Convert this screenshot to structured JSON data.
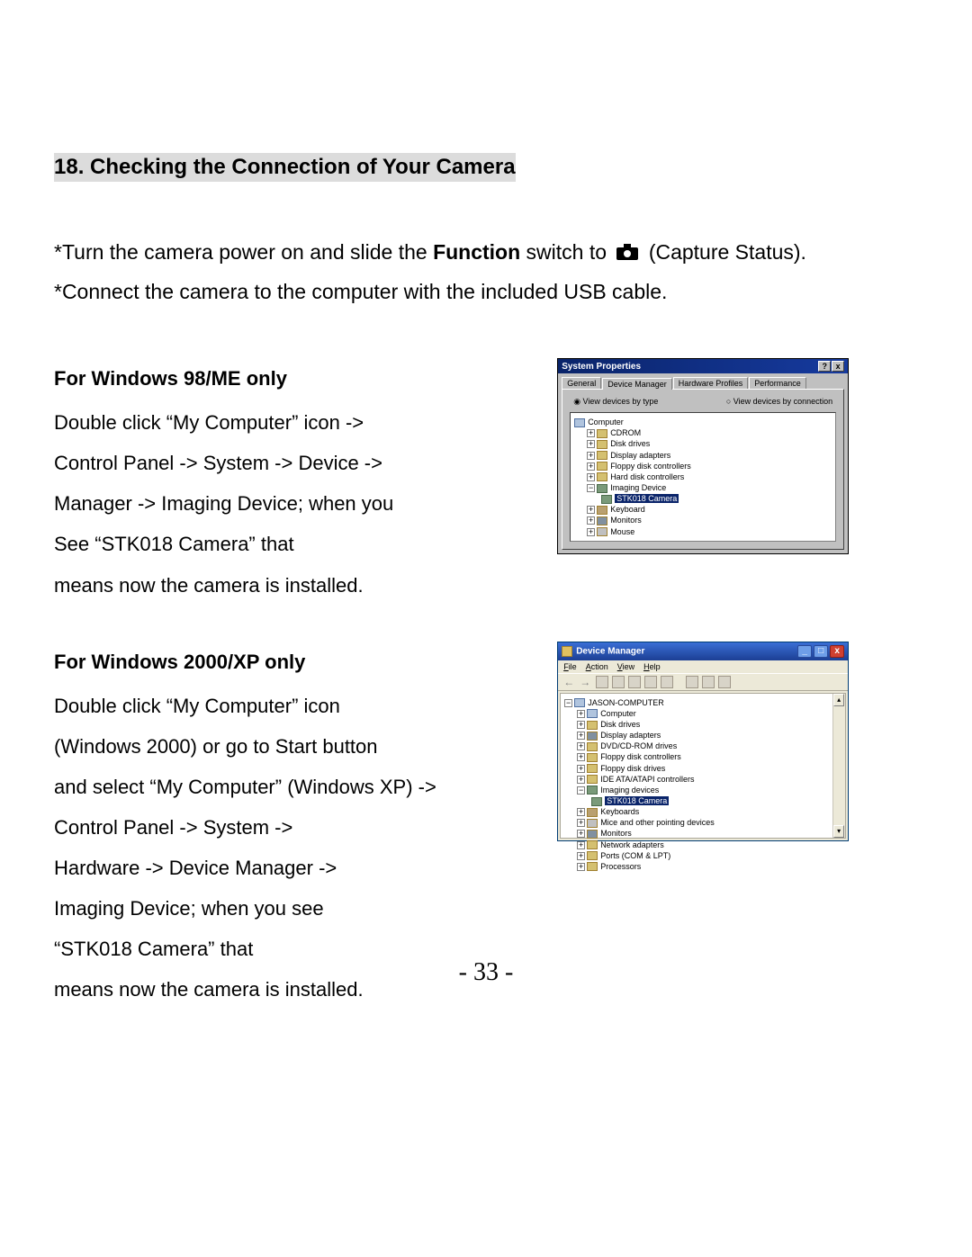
{
  "heading": "18. Checking the Connection of Your Camera",
  "intro": {
    "line1_a": "*Turn the camera power on and slide the ",
    "line1_bold": "Function",
    "line1_b": " switch to ",
    "line1_c": "   (Capture Status).",
    "line2": "*Connect the camera to the computer with the included USB cable."
  },
  "section1": {
    "title": "For Windows 98/ME only",
    "body": "Double click “My Computer” icon ->\nControl Panel -> System -> Device ->\nManager -> Imaging Device; when you\nSee “STK018 Camera” that\nmeans now the camera is installed."
  },
  "section2": {
    "title": "For Windows 2000/XP only",
    "body": "Double click “My Computer” icon\n(Windows 2000) or go to Start button\nand select “My Computer” (Windows XP) ->\nControl Panel -> System ->\nHardware -> Device Manager ->\nImaging Device; when you see\n“STK018 Camera” that\nmeans now the camera is installed."
  },
  "win98": {
    "title": "System Properties",
    "tabs": [
      "General",
      "Device Manager",
      "Hardware Profiles",
      "Performance"
    ],
    "radio1": "View devices by type",
    "radio2": "View devices by connection",
    "tree": {
      "root": "Computer",
      "items": [
        "CDROM",
        "Disk drives",
        "Display adapters",
        "Floppy disk controllers",
        "Hard disk controllers"
      ],
      "imaging_label": "Imaging Device",
      "selected": "STK018 Camera",
      "post_items": [
        "Keyboard",
        "Monitors",
        "Mouse"
      ]
    }
  },
  "xp": {
    "title": "Device Manager",
    "menu": [
      "File",
      "Action",
      "View",
      "Help"
    ],
    "root": "JASON-COMPUTER",
    "items_pre": [
      "Computer",
      "Disk drives",
      "Display adapters",
      "DVD/CD-ROM drives",
      "Floppy disk controllers",
      "Floppy disk drives",
      "IDE ATA/ATAPI controllers"
    ],
    "imaging_label": "Imaging devices",
    "selected": "STK018 Camera",
    "items_post": [
      "Keyboards",
      "Mice and other pointing devices",
      "Monitors",
      "Network adapters",
      "Ports (COM & LPT)",
      "Processors"
    ]
  },
  "page_number": "- 33 -"
}
